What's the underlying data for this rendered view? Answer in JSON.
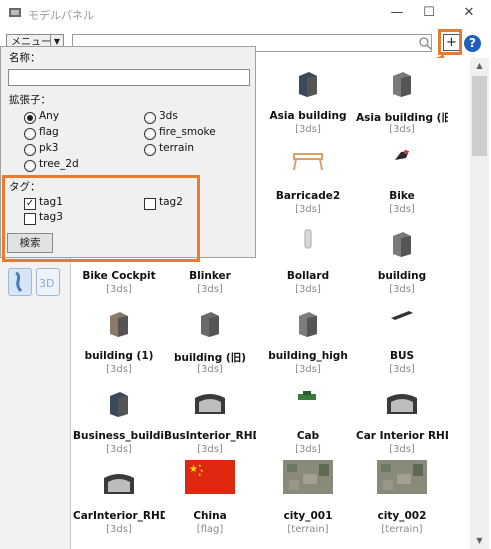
{
  "window": {
    "title": "モデルパネル",
    "minimize": "—",
    "maximize": "☐",
    "close": "✕"
  },
  "toolbar": {
    "menu_label": "メニュー",
    "menu_caret": "▼",
    "plus_label": "+",
    "help_label": "?"
  },
  "panel": {
    "name_label": "名称：",
    "name_value": "",
    "ext_label": "拡張子：",
    "extensions": [
      {
        "label": "Any",
        "selected": true
      },
      {
        "label": "3ds",
        "selected": false
      },
      {
        "label": "flag",
        "selected": false
      },
      {
        "label": "fire_smoke",
        "selected": false
      },
      {
        "label": "pk3",
        "selected": false
      },
      {
        "label": "terrain",
        "selected": false
      },
      {
        "label": "tree_2d",
        "selected": false
      }
    ],
    "tag_label": "タグ：",
    "tags": [
      {
        "label": "tag1",
        "checked": true
      },
      {
        "label": "tag2",
        "checked": false
      },
      {
        "label": "tag3",
        "checked": false
      }
    ],
    "search_button": "検索"
  },
  "items": [
    {
      "name": "Asia building",
      "type": "[3ds]",
      "icon": "building-icon"
    },
    {
      "name": "Asia building (旧)",
      "type": "[3ds]",
      "icon": "building-icon"
    },
    {
      "name": "Barricade2",
      "type": "[3ds]",
      "icon": "barricade-icon"
    },
    {
      "name": "Bike",
      "type": "[3ds]",
      "icon": "bike-icon"
    },
    {
      "name": "Bike Cockpit",
      "type": "[3ds]",
      "icon": "cockpit-icon"
    },
    {
      "name": "Blinker",
      "type": "[3ds]",
      "icon": "blinker-icon"
    },
    {
      "name": "Bollard",
      "type": "[3ds]",
      "icon": "bollard-icon"
    },
    {
      "name": "building",
      "type": "[3ds]",
      "icon": "building-icon"
    },
    {
      "name": "building (1)",
      "type": "[3ds]",
      "icon": "building-icon"
    },
    {
      "name": "building (旧)",
      "type": "[3ds]",
      "icon": "building-icon"
    },
    {
      "name": "building_high",
      "type": "[3ds]",
      "icon": "building-icon"
    },
    {
      "name": "BUS",
      "type": "[3ds]",
      "icon": "bus-icon"
    },
    {
      "name": "Business_buildi...",
      "type": "[3ds]",
      "icon": "building-icon"
    },
    {
      "name": "BusInterior_RHD",
      "type": "[3ds]",
      "icon": "interior-icon"
    },
    {
      "name": "Cab",
      "type": "[3ds]",
      "icon": "car-icon"
    },
    {
      "name": "Car Interior RHD",
      "type": "[3ds]",
      "icon": "interior-icon"
    },
    {
      "name": "CarInterior_RHD",
      "type": "[3ds]",
      "icon": "interior-icon"
    },
    {
      "name": "China",
      "type": "[flag]",
      "icon": "flag-icon"
    },
    {
      "name": "city_001",
      "type": "[terrain]",
      "icon": "terrain-icon"
    },
    {
      "name": "city_002",
      "type": "[terrain]",
      "icon": "terrain-icon"
    }
  ]
}
